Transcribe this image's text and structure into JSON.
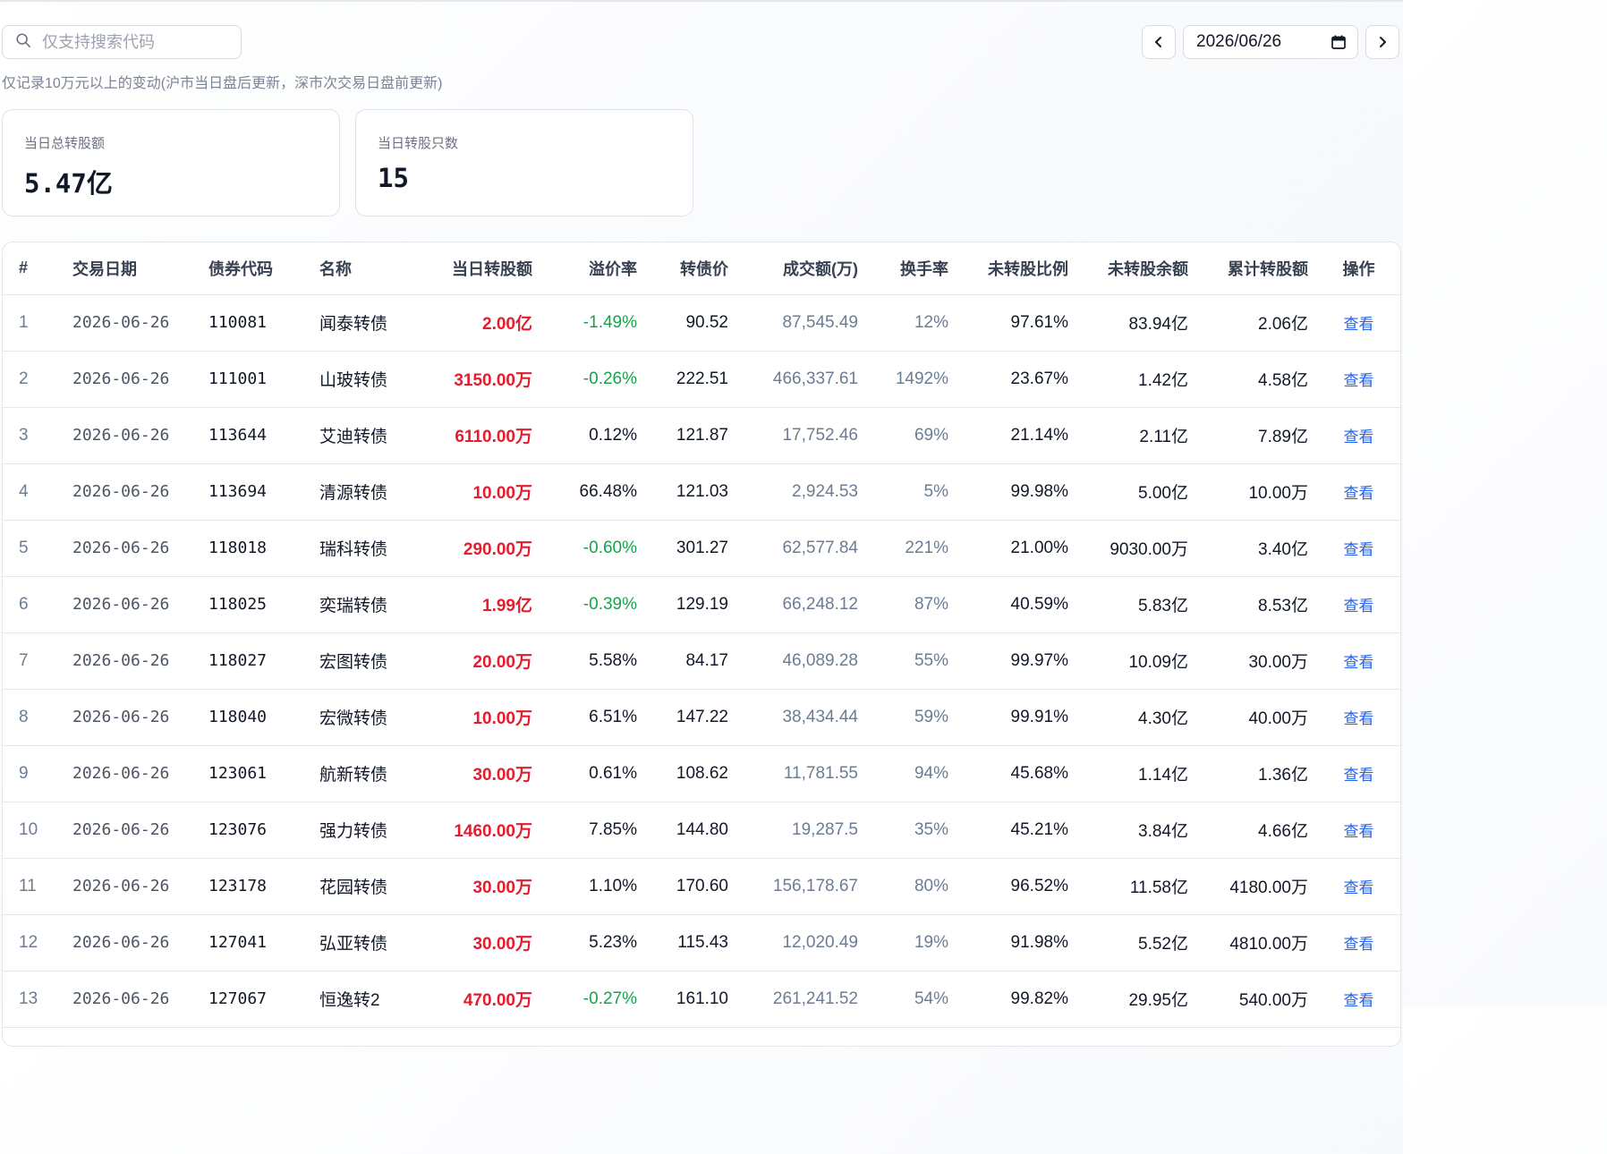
{
  "search": {
    "placeholder": "仅支持搜索代码"
  },
  "notice": "仅记录10万元以上的变动(沪市当日盘后更新，深市次交易日盘前更新)",
  "date_picker": {
    "value": "2026/06/26"
  },
  "cards": [
    {
      "label": "当日总转股额",
      "value": "5.47亿"
    },
    {
      "label": "当日转股只数",
      "value": "15"
    }
  ],
  "table": {
    "headers": [
      "#",
      "交易日期",
      "债券代码",
      "名称",
      "当日转股额",
      "溢价率",
      "转债价",
      "成交额(万)",
      "换手率",
      "未转股比例",
      "未转股余额",
      "累计转股额",
      "操作"
    ],
    "rows": [
      {
        "idx": "1",
        "date": "2026-06-26",
        "code": "110081",
        "name": "闻泰转债",
        "amount": "2.00亿",
        "premium": "-1.49%",
        "neg": true,
        "price": "90.52",
        "turnover": "87,545.49",
        "rate": "12%",
        "ratio": "97.61%",
        "remain": "83.94亿",
        "total": "2.06亿",
        "action": "查看"
      },
      {
        "idx": "2",
        "date": "2026-06-26",
        "code": "111001",
        "name": "山玻转债",
        "amount": "3150.00万",
        "premium": "-0.26%",
        "neg": true,
        "price": "222.51",
        "turnover": "466,337.61",
        "rate": "1492%",
        "ratio": "23.67%",
        "remain": "1.42亿",
        "total": "4.58亿",
        "action": "查看"
      },
      {
        "idx": "3",
        "date": "2026-06-26",
        "code": "113644",
        "name": "艾迪转债",
        "amount": "6110.00万",
        "premium": "0.12%",
        "neg": false,
        "price": "121.87",
        "turnover": "17,752.46",
        "rate": "69%",
        "ratio": "21.14%",
        "remain": "2.11亿",
        "total": "7.89亿",
        "action": "查看"
      },
      {
        "idx": "4",
        "date": "2026-06-26",
        "code": "113694",
        "name": "清源转债",
        "amount": "10.00万",
        "premium": "66.48%",
        "neg": false,
        "price": "121.03",
        "turnover": "2,924.53",
        "rate": "5%",
        "ratio": "99.98%",
        "remain": "5.00亿",
        "total": "10.00万",
        "action": "查看"
      },
      {
        "idx": "5",
        "date": "2026-06-26",
        "code": "118018",
        "name": "瑞科转债",
        "amount": "290.00万",
        "premium": "-0.60%",
        "neg": true,
        "price": "301.27",
        "turnover": "62,577.84",
        "rate": "221%",
        "ratio": "21.00%",
        "remain": "9030.00万",
        "total": "3.40亿",
        "action": "查看"
      },
      {
        "idx": "6",
        "date": "2026-06-26",
        "code": "118025",
        "name": "奕瑞转债",
        "amount": "1.99亿",
        "premium": "-0.39%",
        "neg": true,
        "price": "129.19",
        "turnover": "66,248.12",
        "rate": "87%",
        "ratio": "40.59%",
        "remain": "5.83亿",
        "total": "8.53亿",
        "action": "查看"
      },
      {
        "idx": "7",
        "date": "2026-06-26",
        "code": "118027",
        "name": "宏图转债",
        "amount": "20.00万",
        "premium": "5.58%",
        "neg": false,
        "price": "84.17",
        "turnover": "46,089.28",
        "rate": "55%",
        "ratio": "99.97%",
        "remain": "10.09亿",
        "total": "30.00万",
        "action": "查看"
      },
      {
        "idx": "8",
        "date": "2026-06-26",
        "code": "118040",
        "name": "宏微转债",
        "amount": "10.00万",
        "premium": "6.51%",
        "neg": false,
        "price": "147.22",
        "turnover": "38,434.44",
        "rate": "59%",
        "ratio": "99.91%",
        "remain": "4.30亿",
        "total": "40.00万",
        "action": "查看"
      },
      {
        "idx": "9",
        "date": "2026-06-26",
        "code": "123061",
        "name": "航新转债",
        "amount": "30.00万",
        "premium": "0.61%",
        "neg": false,
        "price": "108.62",
        "turnover": "11,781.55",
        "rate": "94%",
        "ratio": "45.68%",
        "remain": "1.14亿",
        "total": "1.36亿",
        "action": "查看"
      },
      {
        "idx": "10",
        "date": "2026-06-26",
        "code": "123076",
        "name": "强力转债",
        "amount": "1460.00万",
        "premium": "7.85%",
        "neg": false,
        "price": "144.80",
        "turnover": "19,287.5",
        "rate": "35%",
        "ratio": "45.21%",
        "remain": "3.84亿",
        "total": "4.66亿",
        "action": "查看"
      },
      {
        "idx": "11",
        "date": "2026-06-26",
        "code": "123178",
        "name": "花园转债",
        "amount": "30.00万",
        "premium": "1.10%",
        "neg": false,
        "price": "170.60",
        "turnover": "156,178.67",
        "rate": "80%",
        "ratio": "96.52%",
        "remain": "11.58亿",
        "total": "4180.00万",
        "action": "查看"
      },
      {
        "idx": "12",
        "date": "2026-06-26",
        "code": "127041",
        "name": "弘亚转债",
        "amount": "30.00万",
        "premium": "5.23%",
        "neg": false,
        "price": "115.43",
        "turnover": "12,020.49",
        "rate": "19%",
        "ratio": "91.98%",
        "remain": "5.52亿",
        "total": "4810.00万",
        "action": "查看"
      },
      {
        "idx": "13",
        "date": "2026-06-26",
        "code": "127067",
        "name": "恒逸转2",
        "amount": "470.00万",
        "premium": "-0.27%",
        "neg": true,
        "price": "161.10",
        "turnover": "261,241.52",
        "rate": "54%",
        "ratio": "99.82%",
        "remain": "29.95亿",
        "total": "540.00万",
        "action": "查看"
      }
    ]
  }
}
